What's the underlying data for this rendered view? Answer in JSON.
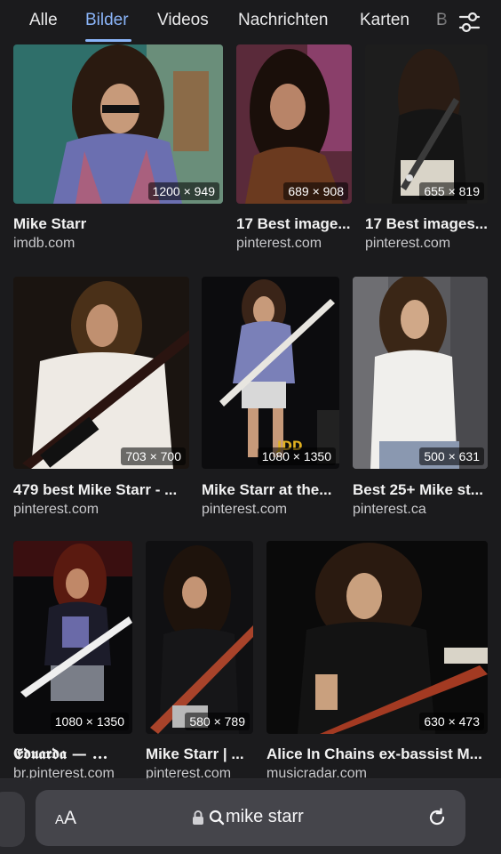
{
  "tabs": [
    {
      "label": "Alle",
      "active": false
    },
    {
      "label": "Bilder",
      "active": true
    },
    {
      "label": "Videos",
      "active": false
    },
    {
      "label": "Nachrichten",
      "active": false
    },
    {
      "label": "Karten",
      "active": false
    },
    {
      "label": "B",
      "active": false
    }
  ],
  "tabs_icon": "sliders-icon",
  "accent_color": "#8ab4f8",
  "results": [
    {
      "title": "Mike Starr",
      "source": "imdb.com",
      "dims": "1200 × 949"
    },
    {
      "title": "17 Best image...",
      "source": "pinterest.com",
      "dims": "689 × 908"
    },
    {
      "title": "17 Best images...",
      "source": "pinterest.com",
      "dims": "655 × 819"
    },
    {
      "title": "479 best Mike Starr - ...",
      "source": "pinterest.com",
      "dims": "703 × 700"
    },
    {
      "title": "Mike Starr at the...",
      "source": "pinterest.com",
      "dims": "1080 × 1350"
    },
    {
      "title": "Best 25+ Mike st...",
      "source": "pinterest.ca",
      "dims": "500 × 631"
    },
    {
      "title": "𝕰𝖉𝖚𝖆𝖗𝖉𝖆 — ...",
      "source": "br.pinterest.com",
      "dims": "1080 × 1350"
    },
    {
      "title": "Mike Starr | ...",
      "source": "pinterest.com",
      "dims": "580 × 789"
    },
    {
      "title": "Alice In Chains ex-bassist M...",
      "source": "musicradar.com",
      "dims": "630 × 473"
    }
  ],
  "toolbar": {
    "text_size_small": "A",
    "text_size_large": "A",
    "query": "mike starr",
    "lock_icon": "lock-icon",
    "search_icon": "search-icon",
    "reload_icon": "reload-icon"
  }
}
